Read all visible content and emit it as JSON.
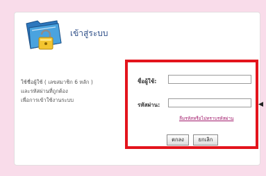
{
  "login": {
    "title": "เข้าสู่ระบบ",
    "instructions": [
      "ใช้ชื่อผู้ใช้ ( เลขสมาชิก 6 หลัก )",
      "และรหัสผ่านที่ถูกต้อง",
      "เพื่อการเข้าใช้งานระบบ"
    ],
    "username_label": "ชื่อผู้ใช้:",
    "username_value": "",
    "password_label": "รหัสผ่าน:",
    "password_value": "",
    "forgot_link": "ลืมรหัสหรือไม่ทราบรหัสผ่าน",
    "ok_button": "ตกลง",
    "cancel_button": "ยกเลิก"
  },
  "icons": {
    "folder": "folder-lock-icon",
    "pointer": "arrow-pointer-icon"
  },
  "colors": {
    "page_background": "#f9dcea",
    "highlight": "#e3141c",
    "title": "#2f4f88",
    "link": "#a11a6b"
  }
}
